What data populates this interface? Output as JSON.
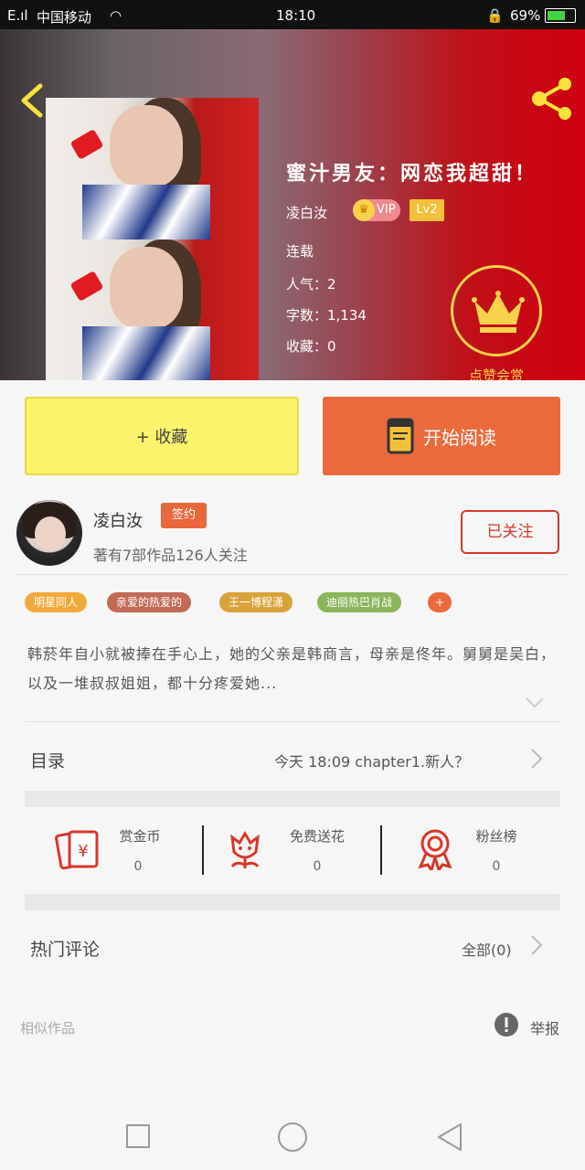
{
  "status_bar": {
    "carrier": "中国移动",
    "time": "18:10",
    "battery": "69%"
  },
  "book": {
    "title": "蜜汁男友：网恋我超甜！",
    "author": "凌白汝",
    "vip_label": "VIP",
    "level": "Lv2",
    "status": "连载",
    "popularity": "人气：2",
    "word_count": "字数：1,134",
    "favorites": "收藏：0",
    "reward_label": "点赞会赏"
  },
  "actions": {
    "collect_label": "+ 收藏",
    "read_label": "开始阅读"
  },
  "author_card": {
    "name": "凌白汝",
    "badge": "签约",
    "works": "著有7部作品126人关注",
    "follow_label": "已关注"
  },
  "tags": [
    {
      "label": "明星同人",
      "color": "#f2a93b"
    },
    {
      "label": "亲爱的热爱的",
      "color": "#c26a55"
    },
    {
      "label": "王一博程潇",
      "color": "#d9a23a"
    },
    {
      "label": "迪丽热巴肖战",
      "color": "#8ab55a"
    },
    {
      "label": "+",
      "color": "#ea6a3c"
    }
  ],
  "description": "韩菸年自小就被捧在手心上，她的父亲是韩商言，母亲是佟年。舅舅是吴白，以及一堆叔叔姐姐，都十分疼爱她...",
  "toc": {
    "label": "目录",
    "latest": "今天 18:09 chapter1.新人？"
  },
  "gifts": [
    {
      "label": "赏金币",
      "value": "0"
    },
    {
      "label": "免费送花",
      "value": "0"
    },
    {
      "label": "粉丝榜",
      "value": "0"
    }
  ],
  "comments": {
    "label": "热门评论",
    "all": "全部(0)"
  },
  "footer": {
    "similar": "相似作品",
    "report": "举报"
  },
  "colors": {
    "accent": "#ea6a3c",
    "collect_bg": "#fbf36c",
    "follow": "#d8372c",
    "gold": "#f7d24a"
  }
}
